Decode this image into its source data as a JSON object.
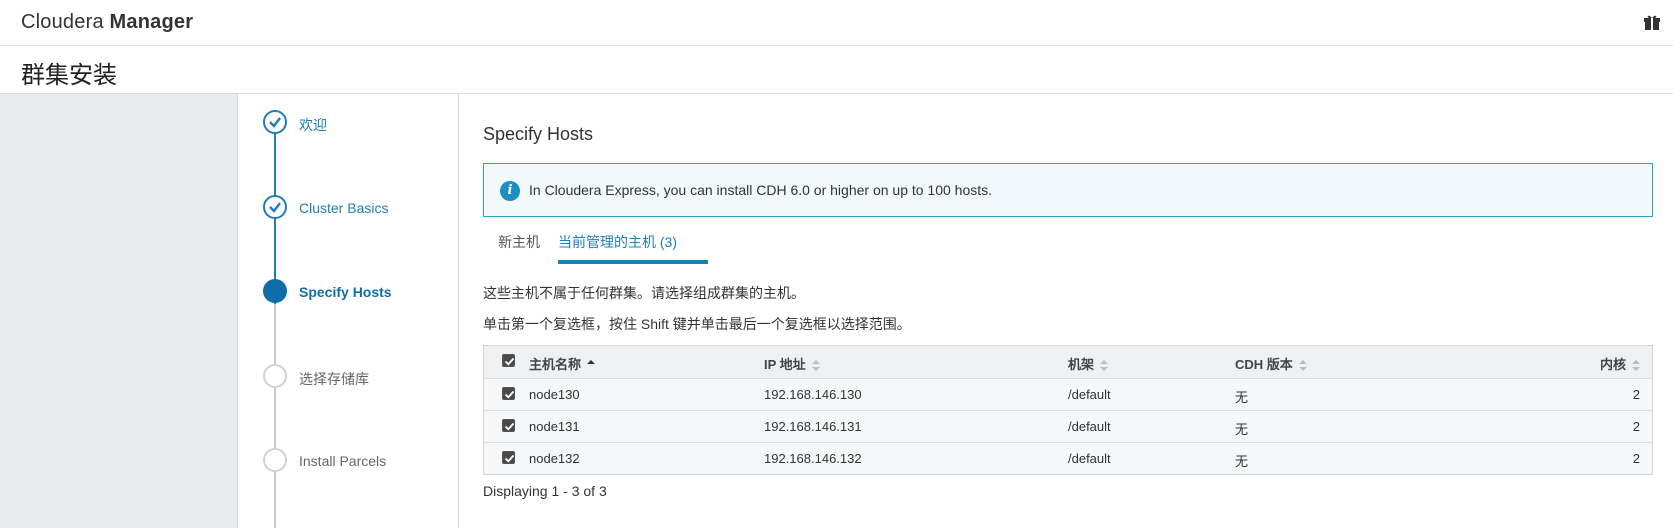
{
  "header": {
    "brand_light": "Cloudera",
    "brand_bold": "Manager",
    "gift_icon": "gift-icon"
  },
  "page": {
    "title": "群集安装"
  },
  "wizard": {
    "steps": [
      {
        "label": "欢迎",
        "state": "done"
      },
      {
        "label": "Cluster Basics",
        "state": "done"
      },
      {
        "label": "Specify Hosts",
        "state": "active"
      },
      {
        "label": "选择存储库",
        "state": "todo"
      },
      {
        "label": "Install Parcels",
        "state": "todo"
      }
    ]
  },
  "main": {
    "section_title": "Specify Hosts",
    "info_icon": "info-icon",
    "info_message": "In Cloudera Express, you can install CDH 6.0 or higher on up to 100 hosts.",
    "tabs": [
      {
        "label": "新主机",
        "active": false
      },
      {
        "label": "当前管理的主机 (3)",
        "active": true
      }
    ],
    "note1": "这些主机不属于任何群集。请选择组成群集的主机。",
    "note2": "单击第一个复选框，按住 Shift 键并单击最后一个复选框以选择范围。",
    "table": {
      "headers": {
        "name": "主机名称",
        "ip": "IP 地址",
        "rack": "机架",
        "cdh": "CDH 版本",
        "cores": "内核"
      },
      "sorted_by": "name",
      "sort_direction": "ascending",
      "select_all_checked": true,
      "rows": [
        {
          "checked": true,
          "name": "node130",
          "ip": "192.168.146.130",
          "rack": "/default",
          "cdh": "无",
          "cores": "2"
        },
        {
          "checked": true,
          "name": "node131",
          "ip": "192.168.146.131",
          "rack": "/default",
          "cdh": "无",
          "cores": "2"
        },
        {
          "checked": true,
          "name": "node132",
          "ip": "192.168.146.132",
          "rack": "/default",
          "cdh": "无",
          "cores": "2"
        }
      ]
    },
    "display_count": "Displaying 1 - 3 of 3"
  },
  "colors": {
    "accent": "#1f7fb4",
    "active_step": "#0f6ea8",
    "info_border": "#29a3d0",
    "info_bg": "#f1f9fc",
    "left_panel": "#e8ecee"
  }
}
